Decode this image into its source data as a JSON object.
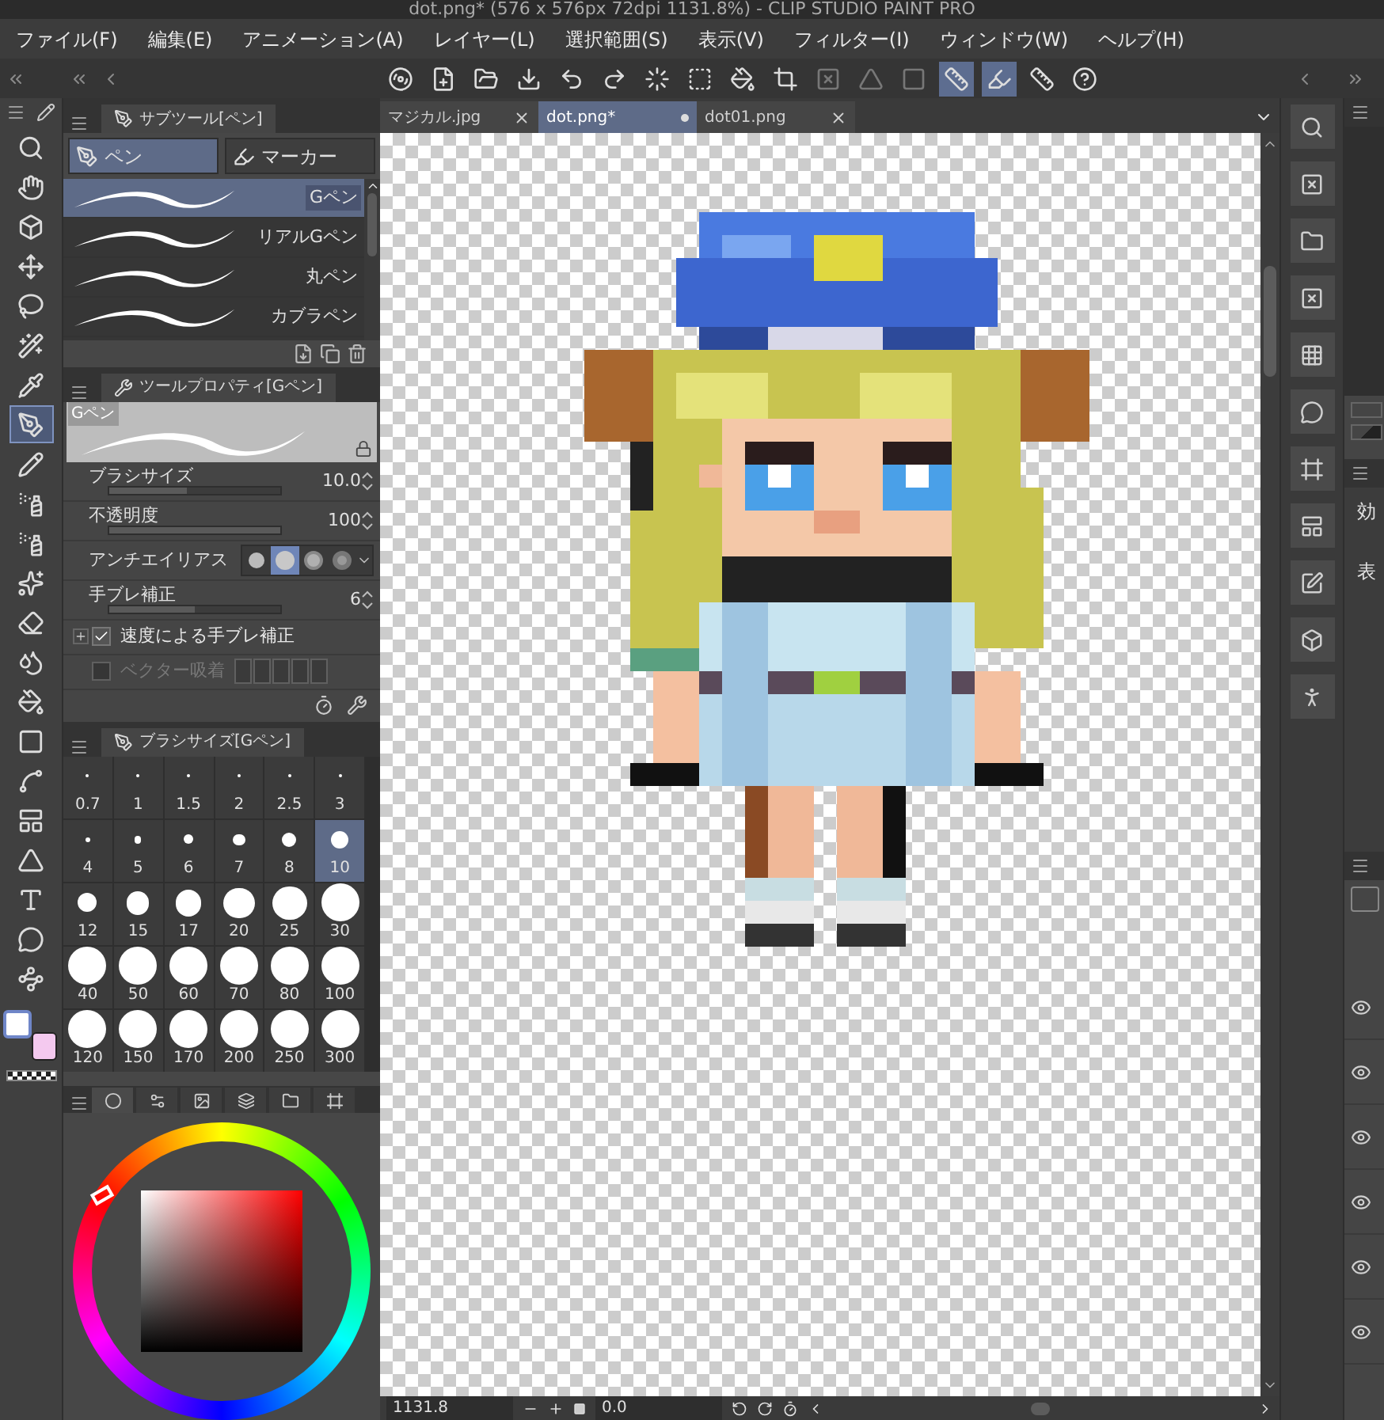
{
  "title_bar": {
    "title": "dot.png* (576 x 576px 72dpi 1131.8%) - CLIP STUDIO PAINT PRO"
  },
  "menu": [
    "ファイル(F)",
    "編集(E)",
    "アニメーション(A)",
    "レイヤー(L)",
    "選択範囲(S)",
    "表示(V)",
    "フィルター(I)",
    "ウィンドウ(W)",
    "ヘルプ(H)"
  ],
  "toolbar": [
    {
      "selected": false
    },
    {
      "selected": false
    },
    {
      "selected": false
    },
    {
      "selected": false
    },
    {
      "selected": false
    },
    {
      "selected": false
    },
    {
      "selected": false
    },
    {
      "selected": false
    },
    {
      "selected": false
    },
    {
      "selected": false
    },
    {
      "selected": false
    },
    {
      "selected": false
    },
    {
      "selected": false
    },
    {
      "selected": true
    },
    {
      "selected": true
    },
    {
      "selected": false
    },
    {
      "selected": false
    }
  ],
  "tools": [
    {
      "selected": false
    },
    {
      "selected": false
    },
    {
      "selected": false
    },
    {
      "selected": false
    },
    {
      "selected": false
    },
    {
      "selected": false
    },
    {
      "selected": false
    },
    {
      "selected": true
    },
    {
      "selected": false
    },
    {
      "selected": false
    },
    {
      "selected": false
    },
    {
      "selected": false
    },
    {
      "selected": false
    },
    {
      "selected": false
    },
    {
      "selected": false
    },
    {
      "selected": false
    },
    {
      "selected": false
    },
    {
      "selected": false
    },
    {
      "selected": false
    },
    {
      "selected": false
    },
    {
      "selected": false
    },
    {
      "selected": false
    }
  ],
  "colors": [
    {
      "kind": "main",
      "color": "#ffffff",
      "selected": true
    },
    {
      "kind": "sub",
      "color": "#f4c9ef",
      "selected": false
    }
  ],
  "subtool": {
    "title": "サブツール[ペン]",
    "groups": [
      {
        "label": "ペン",
        "selected": true
      },
      {
        "label": "マーカー",
        "selected": false
      }
    ],
    "brushes": [
      {
        "name": "Gペン",
        "selected": true
      },
      {
        "name": "リアルGペン",
        "selected": false
      },
      {
        "name": "丸ペン",
        "selected": false
      },
      {
        "name": "カブラペン",
        "selected": false
      }
    ]
  },
  "tool_property": {
    "title": "ツールプロパティ[Gペン]",
    "preview_label": "Gペン",
    "rows": [
      {
        "kind": "slider",
        "label": "ブラシサイズ",
        "value": "10.0",
        "level": 0.45
      },
      {
        "kind": "slider",
        "label": "不透明度",
        "value": "100",
        "level": 1
      },
      {
        "kind": "antialias",
        "label": "アンチエイリアス",
        "options": [
          {
            "selected": false
          },
          {
            "selected": true
          },
          {
            "selected": false
          },
          {
            "selected": false
          }
        ]
      },
      {
        "kind": "slider",
        "label": "手ブレ補正",
        "value": "6",
        "level": 0.5
      },
      {
        "kind": "checkbox",
        "label": "速度による手ブレ補正",
        "checked": true,
        "disabled": false
      },
      {
        "kind": "checkbox",
        "label": "ベクター吸着",
        "checked": false,
        "disabled": true
      }
    ]
  },
  "brush_size": {
    "title": "ブラシサイズ[Gペン]",
    "sizes": [
      {
        "label": "0.7",
        "selected": false
      },
      {
        "label": "1",
        "selected": false
      },
      {
        "label": "1.5",
        "selected": false
      },
      {
        "label": "2",
        "selected": false
      },
      {
        "label": "2.5",
        "selected": false
      },
      {
        "label": "3",
        "selected": false
      },
      {
        "label": "4",
        "selected": false
      },
      {
        "label": "5",
        "selected": false
      },
      {
        "label": "6",
        "selected": false
      },
      {
        "label": "7",
        "selected": false
      },
      {
        "label": "8",
        "selected": false
      },
      {
        "label": "10",
        "selected": true
      },
      {
        "label": "12",
        "selected": false
      },
      {
        "label": "15",
        "selected": false
      },
      {
        "label": "17",
        "selected": false
      },
      {
        "label": "20",
        "selected": false
      },
      {
        "label": "25",
        "selected": false
      },
      {
        "label": "30",
        "selected": false
      },
      {
        "label": "40",
        "selected": false
      },
      {
        "label": "50",
        "selected": false
      },
      {
        "label": "60",
        "selected": false
      },
      {
        "label": "70",
        "selected": false
      },
      {
        "label": "80",
        "selected": false
      },
      {
        "label": "100",
        "selected": false
      },
      {
        "label": "120",
        "selected": false
      },
      {
        "label": "150",
        "selected": false
      },
      {
        "label": "170",
        "selected": false
      },
      {
        "label": "200",
        "selected": false
      },
      {
        "label": "250",
        "selected": false
      },
      {
        "label": "300",
        "selected": false
      }
    ]
  },
  "color_tabs": [
    {
      "selected": true
    },
    {
      "selected": false
    },
    {
      "selected": false
    },
    {
      "selected": false
    },
    {
      "selected": false
    },
    {
      "selected": false
    }
  ],
  "canvas_tabs": [
    {
      "label": "マジカル.jpg",
      "selected": false
    },
    {
      "label": "dot.png*",
      "selected": true
    },
    {
      "label": "dot01.png",
      "selected": false
    }
  ],
  "status_bar": {
    "zoom": "1131.8",
    "rotation": "0.0"
  },
  "right_panel": {
    "labels": [
      "効",
      "表"
    ]
  }
}
